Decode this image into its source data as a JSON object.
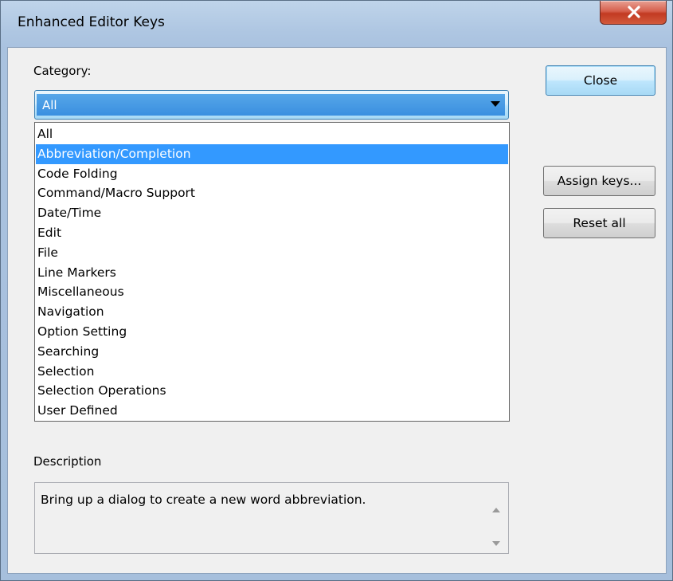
{
  "window": {
    "title": "Enhanced Editor Keys"
  },
  "category": {
    "label": "Category:",
    "selected": "All",
    "options": [
      "All",
      "Abbreviation/Completion",
      "Code Folding",
      "Command/Macro Support",
      "Date/Time",
      "Edit",
      "File",
      "Line Markers",
      "Miscellaneous",
      "Navigation",
      "Option Setting",
      "Searching",
      "Selection",
      "Selection Operations",
      "User Defined"
    ],
    "highlighted": "Abbreviation/Completion"
  },
  "buttons": {
    "close": "Close",
    "assign_keys": "Assign keys...",
    "reset_all": "Reset all"
  },
  "description": {
    "label": "Description",
    "text": "Bring up a dialog to create a new word abbreviation."
  },
  "colors": {
    "selection": "#3399ff",
    "close_button": "#c23a22"
  },
  "icons": {
    "window_close": "close-icon",
    "dropdown": "chevron-down-icon",
    "scroll_up": "scroll-up-arrow-icon",
    "scroll_down": "scroll-down-arrow-icon"
  }
}
